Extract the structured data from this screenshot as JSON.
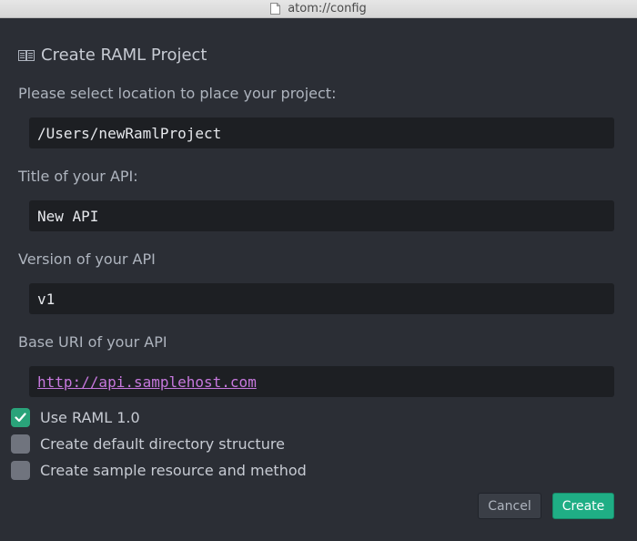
{
  "window": {
    "title": "atom://config"
  },
  "dialog": {
    "title": "Create RAML Project",
    "location_label": "Please select location to place your project:",
    "location_value": "/Users/newRamlProject",
    "title_label": "Title of your API:",
    "title_value": "New API",
    "version_label": "Version of your API",
    "version_value": "v1",
    "base_uri_label": "Base URI of your API",
    "base_uri_value": "http://api.samplehost.com",
    "options": [
      {
        "label": "Use RAML 1.0",
        "checked": true
      },
      {
        "label": "Create default directory structure",
        "checked": false
      },
      {
        "label": "Create sample resource and method",
        "checked": false
      }
    ],
    "cancel_label": "Cancel",
    "create_label": "Create"
  },
  "colors": {
    "background": "#2b2e35",
    "field_background": "#1d1f23",
    "accent_green": "#1fae85",
    "link_purple": "#c678dd"
  }
}
